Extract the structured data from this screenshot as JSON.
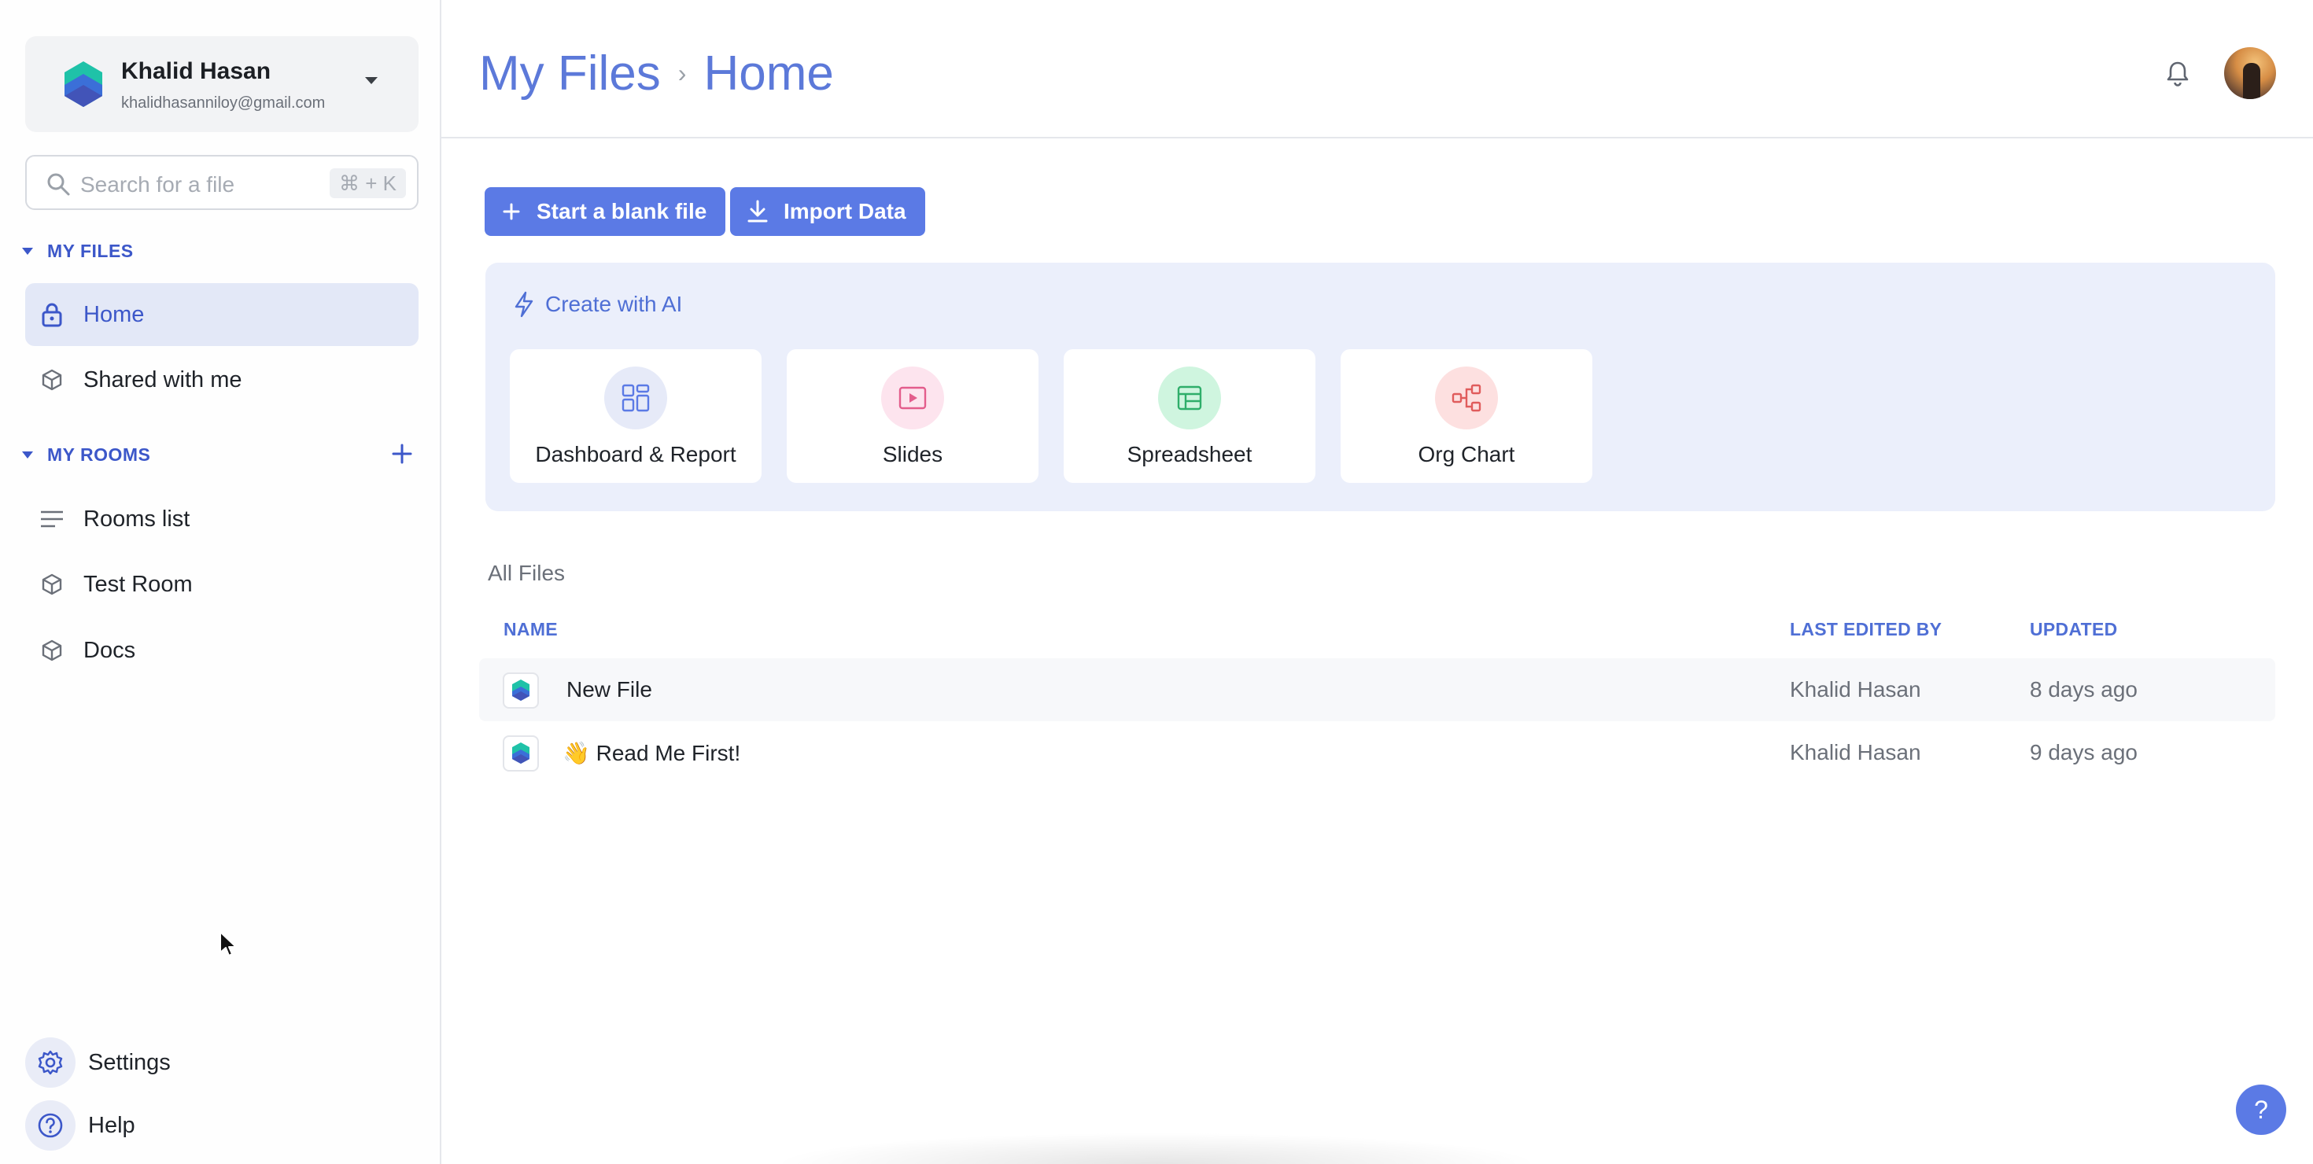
{
  "user": {
    "name": "Khalid Hasan",
    "email": "khalidhasanniloy@gmail.com"
  },
  "search": {
    "placeholder": "Search for a file",
    "shortcut": "⌘ + K"
  },
  "sidebar": {
    "my_files_heading": "MY FILES",
    "my_files_items": [
      {
        "label": "Home",
        "icon": "lock-icon",
        "active": true
      },
      {
        "label": "Shared with me",
        "icon": "cube-icon",
        "active": false
      }
    ],
    "my_rooms_heading": "MY ROOMS",
    "my_rooms_items": [
      {
        "label": "Rooms list",
        "icon": "list-icon"
      },
      {
        "label": "Test Room",
        "icon": "cube-icon"
      },
      {
        "label": "Docs",
        "icon": "cube-icon"
      }
    ],
    "footer": [
      {
        "label": "Settings",
        "icon": "gear-icon"
      },
      {
        "label": "Help",
        "icon": "help-circle-icon"
      }
    ]
  },
  "header": {
    "breadcrumb": [
      "My Files",
      "Home"
    ]
  },
  "actions": {
    "blank_file": "Start a blank file",
    "import_data": "Import Data"
  },
  "ai": {
    "heading": "Create with AI",
    "cards": [
      {
        "label": "Dashboard & Report",
        "icon": "dashboard-icon",
        "color": "#5b7ae5",
        "bg": "#e6eaf8"
      },
      {
        "label": "Slides",
        "icon": "slides-icon",
        "color": "#e35d8c",
        "bg": "#fde4ee"
      },
      {
        "label": "Spreadsheet",
        "icon": "spreadsheet-icon",
        "color": "#2fae6a",
        "bg": "#cff5df"
      },
      {
        "label": "Org Chart",
        "icon": "org-chart-icon",
        "color": "#e05c5c",
        "bg": "#fde0e0"
      }
    ]
  },
  "files": {
    "heading": "All Files",
    "columns": {
      "name": "NAME",
      "last_edited_by": "LAST EDITED BY",
      "updated": "UPDATED"
    },
    "rows": [
      {
        "name": "New File",
        "editor": "Khalid Hasan",
        "updated": "8 days ago"
      },
      {
        "name": "👋 Read Me First!",
        "editor": "Khalid Hasan",
        "updated": "9 days ago"
      }
    ]
  },
  "help_fab": "?",
  "colors": {
    "accent": "#5b7ae5",
    "accent_text": "#3c57c9",
    "ai_panel_bg": "#ebeffb"
  }
}
